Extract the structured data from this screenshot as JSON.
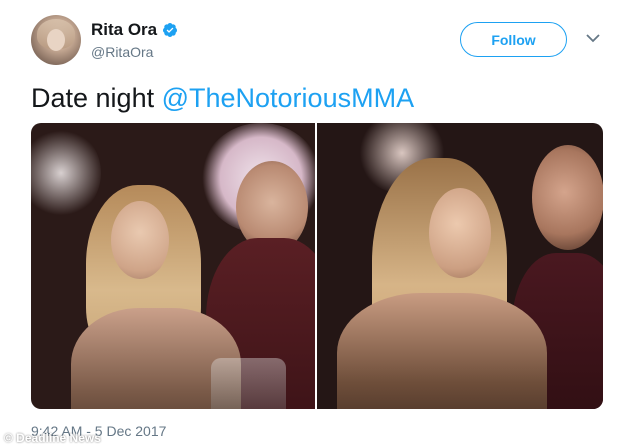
{
  "tweet": {
    "author": {
      "display_name": "Rita Ora",
      "handle": "@RitaOra",
      "verified": true
    },
    "follow_label": "Follow",
    "text_plain": "Date night ",
    "text_mention": "@TheNotoriousMMA",
    "photos": [
      "photo-left",
      "photo-right"
    ],
    "timestamp": "9:42 AM - 5 Dec 2017"
  },
  "watermark": "© Deadline News",
  "colors": {
    "accent": "#1da1f2",
    "text_primary": "#14171a",
    "text_secondary": "#657786"
  },
  "icons": {
    "verified": "verified-badge-icon",
    "more": "chevron-down-icon"
  }
}
